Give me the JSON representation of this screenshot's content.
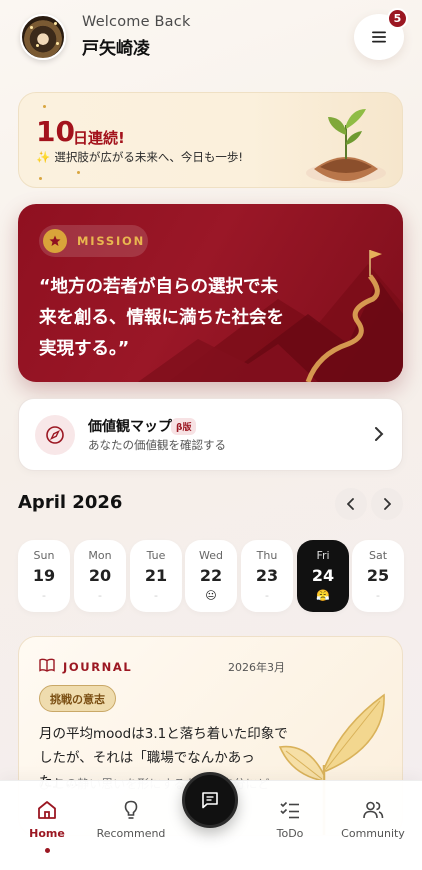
{
  "header": {
    "welcome": "Welcome Back",
    "username": "戸矢崎凌",
    "notification_count": "5",
    "menu_icon": "menu-icon"
  },
  "streak": {
    "number": "10",
    "label": "日連続!",
    "subtitle": "選択肢が広がる未来へ、今日も一歩!",
    "sparkle": "✨"
  },
  "mission": {
    "tag": "MISSION",
    "text": "“地方の若者が自らの選択で未来を創る、情報に満ちた社会を実現する。”"
  },
  "values_map": {
    "title": "価値観マップ",
    "beta": "β版",
    "subtitle": "あなたの価値観を確認する"
  },
  "calendar": {
    "title": "April 2026",
    "days": [
      {
        "name": "Sun",
        "date": "19",
        "mood": "-"
      },
      {
        "name": "Mon",
        "date": "20",
        "mood": "-"
      },
      {
        "name": "Tue",
        "date": "21",
        "mood": "-"
      },
      {
        "name": "Wed",
        "date": "22",
        "mood": "😐"
      },
      {
        "name": "Thu",
        "date": "23",
        "mood": "-"
      },
      {
        "name": "Fri",
        "date": "24",
        "mood": "😤"
      },
      {
        "name": "Sat",
        "date": "25",
        "mood": "-"
      }
    ]
  },
  "journal": {
    "label": "JOURNAL",
    "date": "2026年3月",
    "chip": "挑戦の意志",
    "body": "月の平均moodは3.1と落ち着いた印象でしたが、それは「職場でなんかあった」...",
    "body_more": "○ この静い思いを形にするために自分にど"
  },
  "bottom_nav": {
    "home": "Home",
    "recommend": "Recommend",
    "todo": "ToDo",
    "community": "Community"
  },
  "colors": {
    "accent": "#9b1722",
    "gold": "#d9a43a",
    "mission_bg": "#8f1020"
  }
}
